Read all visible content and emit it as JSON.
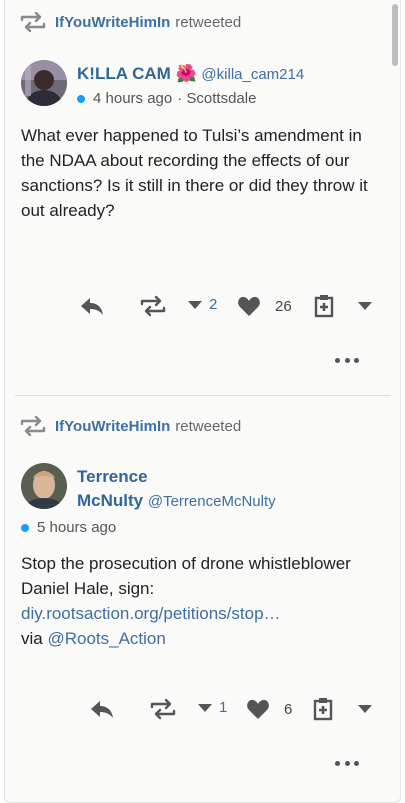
{
  "posts": [
    {
      "retweeted_by": "IfYouWriteHimIn",
      "retweet_label": "retweeted",
      "author_name": "K!LLA CAM 🌺",
      "author_handle": "@killa_cam214",
      "time": "4 hours ago",
      "location": "· Scottsdale",
      "text": "What ever happened to Tulsi’s amendment in the NDAA about recording the effects of our sanctions? Is it still in there or did they throw it out already?",
      "downvote_count": "2",
      "like_count": "26"
    },
    {
      "retweeted_by": "IfYouWriteHimIn",
      "retweet_label": "retweeted",
      "author_name_line1": "Terrence",
      "author_name_line2": "McNulty",
      "author_handle": "@TerrenceMcNulty",
      "time": "5 hours ago",
      "text": "Stop the prosecution of drone whistleblower Daniel Hale, sign:",
      "link": "diy.rootsaction.org/petitions/stop…",
      "via": "via",
      "via_handle": "@Roots_Action",
      "downvote_count": "1",
      "like_count": "6"
    }
  ],
  "colors": {
    "accent": "#3d6fa3",
    "online_dot": "#1a9ef5"
  }
}
